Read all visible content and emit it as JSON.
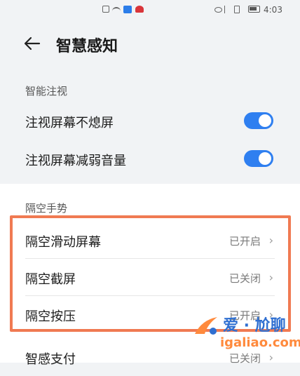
{
  "status_bar": {
    "time": "4:03"
  },
  "header": {
    "title": "智慧感知"
  },
  "sections": {
    "smart_gaze": {
      "label": "智能注视",
      "items": [
        {
          "label": "注视屏幕不熄屏",
          "enabled": true
        },
        {
          "label": "注视屏幕减弱音量",
          "enabled": true
        }
      ]
    },
    "air_gesture": {
      "label": "隔空手势",
      "items": [
        {
          "label": "隔空滑动屏幕",
          "value": "已开启"
        },
        {
          "label": "隔空截屏",
          "value": "已关闭"
        },
        {
          "label": "隔空按压",
          "value": "已开启"
        }
      ]
    },
    "smart_pay": {
      "label": "智感支付",
      "value": "已关闭"
    }
  },
  "watermark": {
    "text": "爱 · 尬聊",
    "url": "igaliao.com"
  },
  "colors": {
    "accent": "#2f7ff0",
    "highlight": "#f07a52"
  }
}
